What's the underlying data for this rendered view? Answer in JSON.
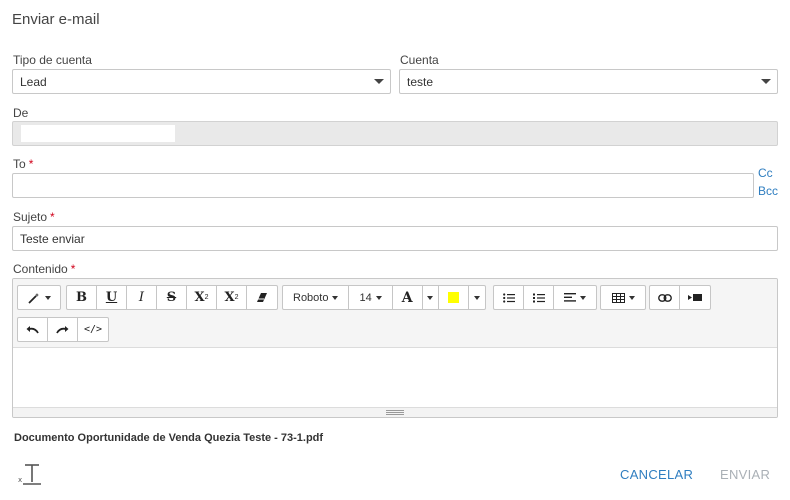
{
  "dialog": {
    "title": "Enviar e-mail"
  },
  "form": {
    "account_type": {
      "label": "Tipo de cuenta",
      "value": "Lead"
    },
    "account": {
      "label": "Cuenta",
      "value": "teste"
    },
    "from": {
      "label": "De",
      "value": ""
    },
    "to": {
      "label": "To",
      "required_mark": "*",
      "value": ""
    },
    "cc_label": "Cc",
    "bcc_label": "Bcc",
    "subject": {
      "label": "Sujeto",
      "required_mark": "*",
      "value": "Teste enviar"
    },
    "content": {
      "label": "Contenido",
      "required_mark": "*"
    }
  },
  "editor": {
    "toolbar": {
      "bold": "B",
      "underline": "U",
      "italic": "I",
      "strikethrough": "S",
      "superscript": "X",
      "subscript": "X",
      "font_family": "Roboto",
      "font_size": "14",
      "font_color": "A",
      "highlight_color": "#ffff00",
      "code_view": "</>"
    },
    "icons": [
      "magic-wand-icon",
      "eraser-icon",
      "unordered-list-icon",
      "ordered-list-icon",
      "align-icon",
      "table-icon",
      "link-icon",
      "video-icon",
      "undo-icon",
      "redo-icon",
      "code-view-icon",
      "clear-format-icon"
    ]
  },
  "attachment": {
    "filename": "Documento Oportunidade de Venda Quezia Teste - 73-1.pdf"
  },
  "actions": {
    "cancel_label": "CANCELAR",
    "send_label": "ENVIAR"
  },
  "colors": {
    "link": "#2f7ec0",
    "required": "#d0021b",
    "disabled_text": "#aab0b6"
  }
}
